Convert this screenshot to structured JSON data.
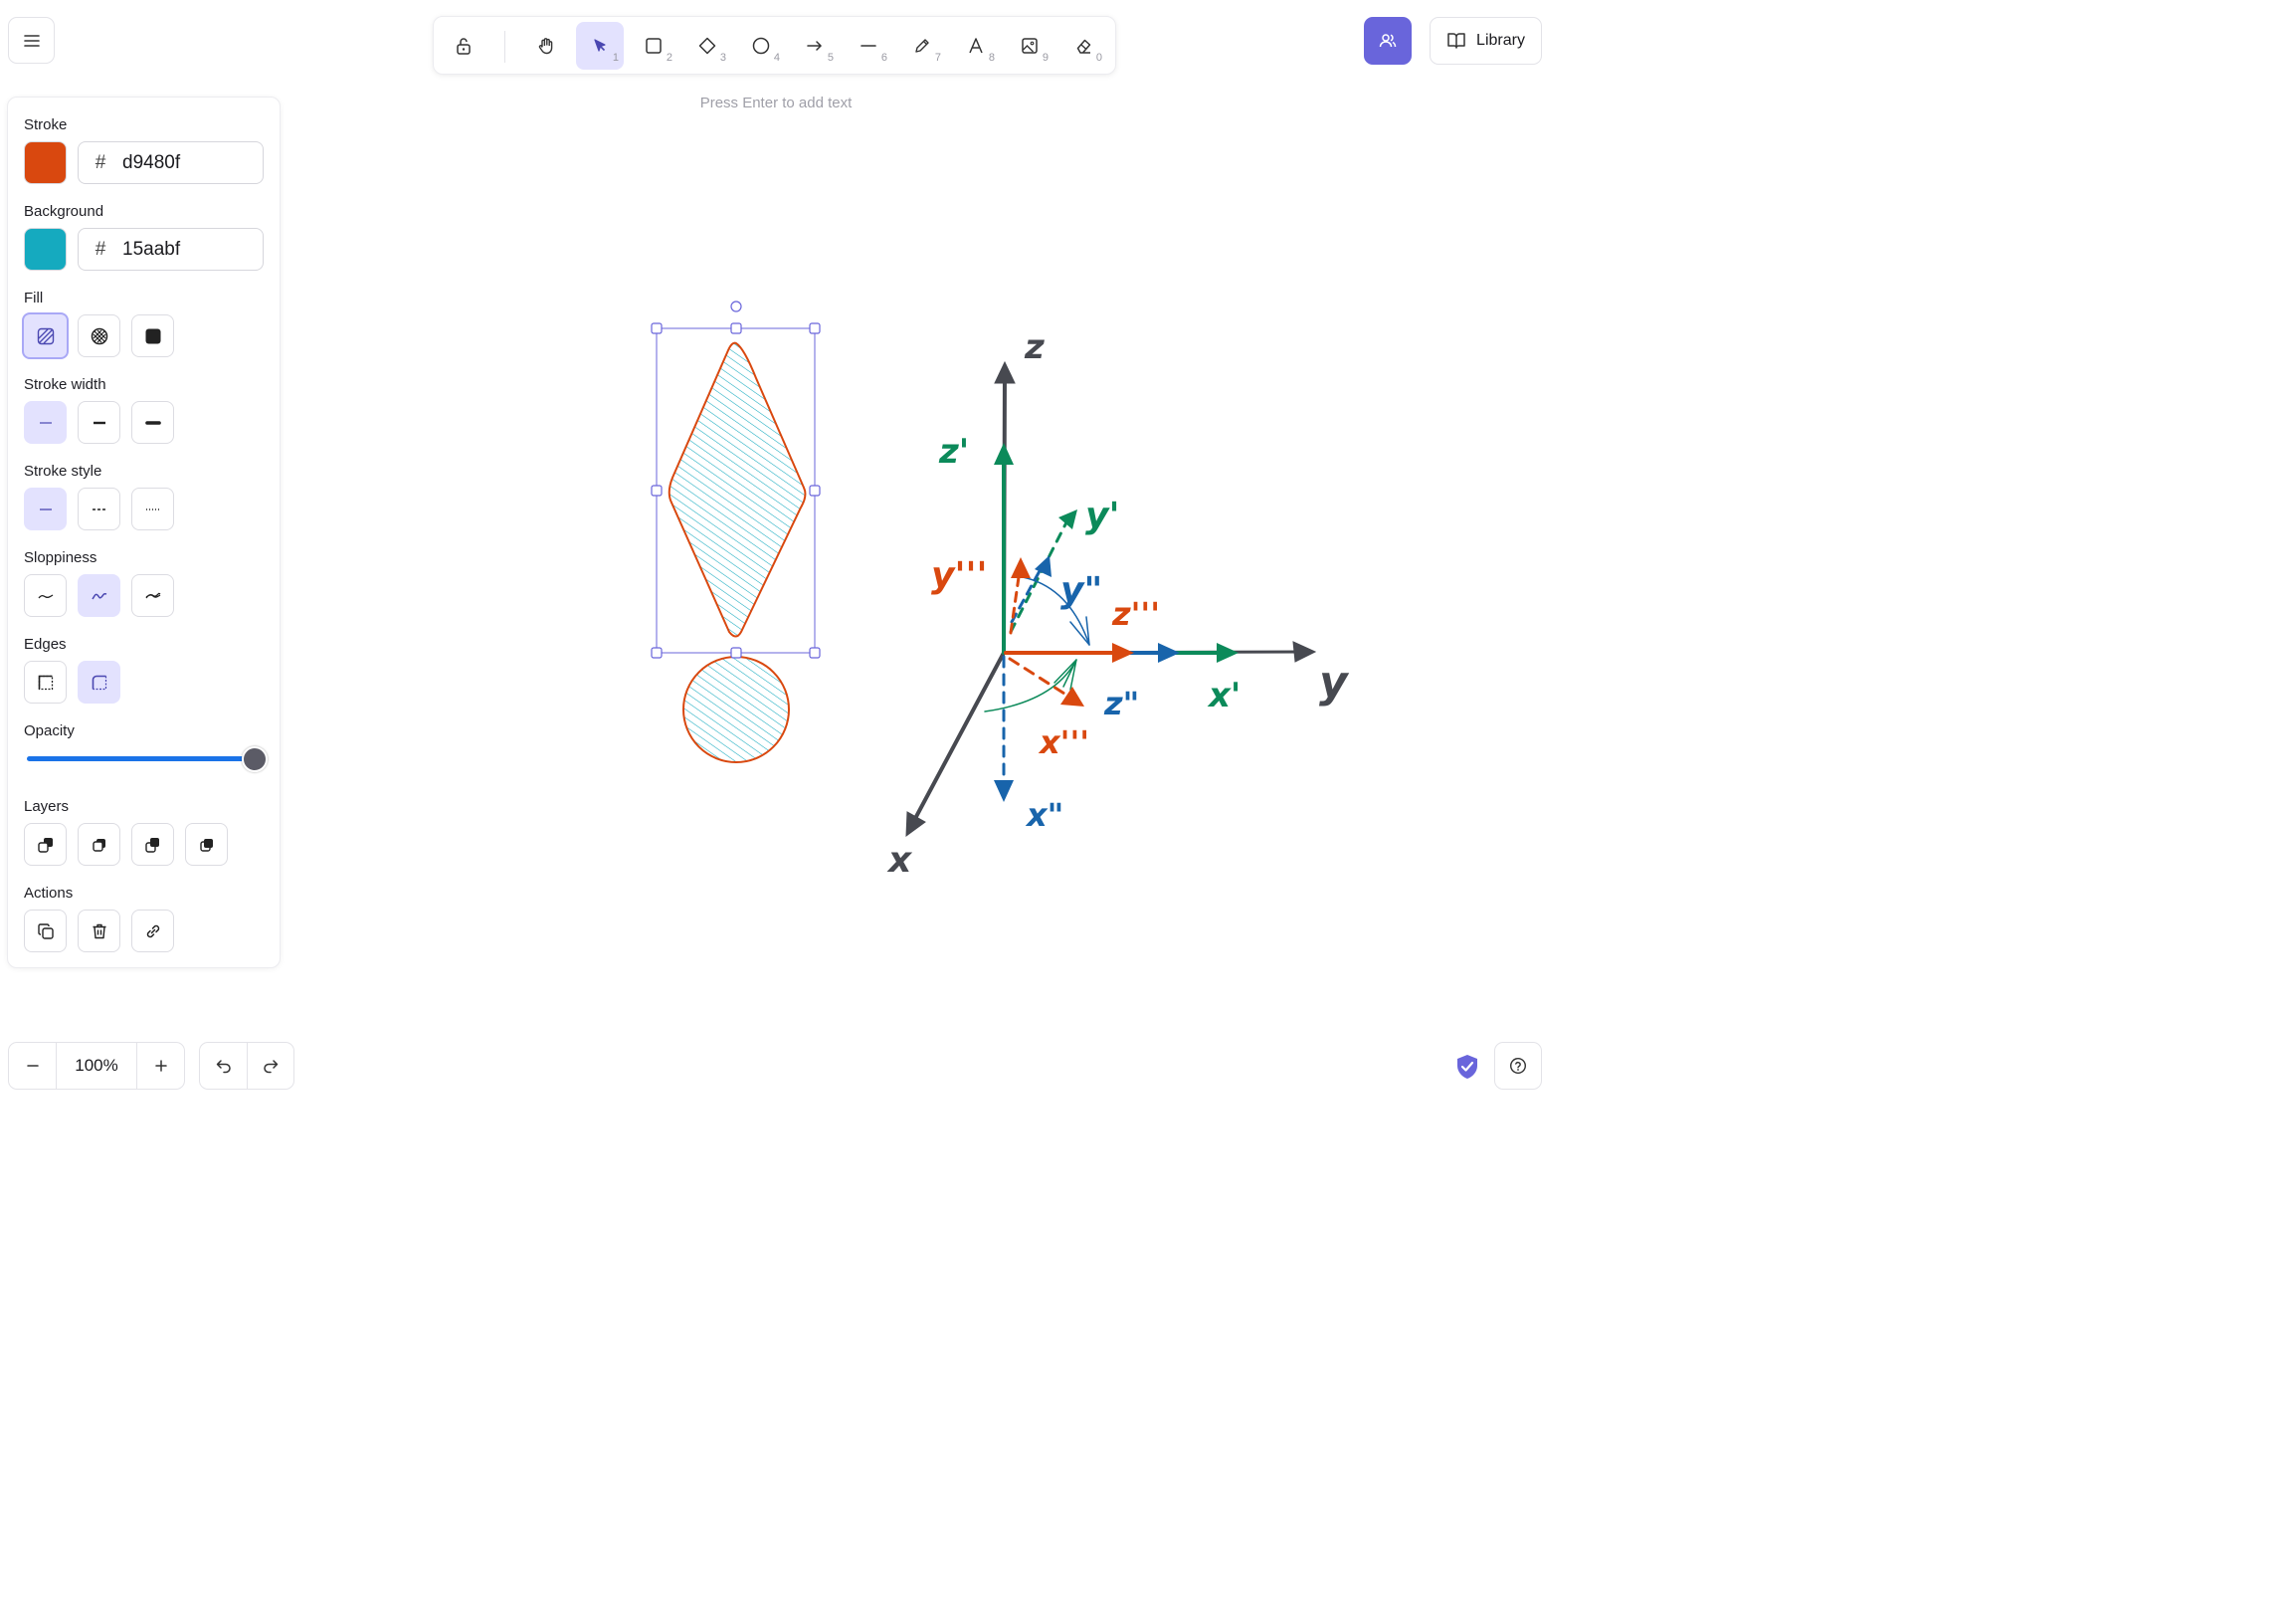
{
  "toolbar": {
    "tools": [
      {
        "name": "hand",
        "key": ""
      },
      {
        "name": "selection",
        "key": "1"
      },
      {
        "name": "rectangle",
        "key": "2"
      },
      {
        "name": "diamond",
        "key": "3"
      },
      {
        "name": "ellipse",
        "key": "4"
      },
      {
        "name": "arrow",
        "key": "5"
      },
      {
        "name": "line",
        "key": "6"
      },
      {
        "name": "draw",
        "key": "7"
      },
      {
        "name": "text",
        "key": "8"
      },
      {
        "name": "image",
        "key": "9"
      },
      {
        "name": "eraser",
        "key": "0"
      }
    ],
    "active_tool": "selection",
    "hint": "Press Enter to add text"
  },
  "header": {
    "library_label": "Library"
  },
  "panel": {
    "stroke": {
      "label": "Stroke",
      "hex": "d9480f",
      "color": "#d9480f"
    },
    "background": {
      "label": "Background",
      "hex": "15aabf",
      "color": "#15aabf"
    },
    "fill_label": "Fill",
    "stroke_width_label": "Stroke width",
    "stroke_style_label": "Stroke style",
    "sloppiness_label": "Sloppiness",
    "edges_label": "Edges",
    "opacity_label": "Opacity",
    "opacity": 100,
    "layers_label": "Layers",
    "actions_label": "Actions",
    "hash": "#"
  },
  "footer": {
    "zoom": "100%"
  },
  "canvas_labels": {
    "z": "z",
    "y": "y",
    "x": "x",
    "z1": "z'",
    "y1": "y'",
    "x1": "x'",
    "z2": "z\"",
    "y2": "y\"",
    "x2": "x\"",
    "z3": "z'''",
    "y3": "y'''",
    "x3": "x'''"
  },
  "colors": {
    "accent": "#6965db",
    "green": "#0c8a5a",
    "blue": "#1864ab",
    "orange": "#d9480f",
    "gray": "#474950",
    "teal": "#15aabf"
  }
}
